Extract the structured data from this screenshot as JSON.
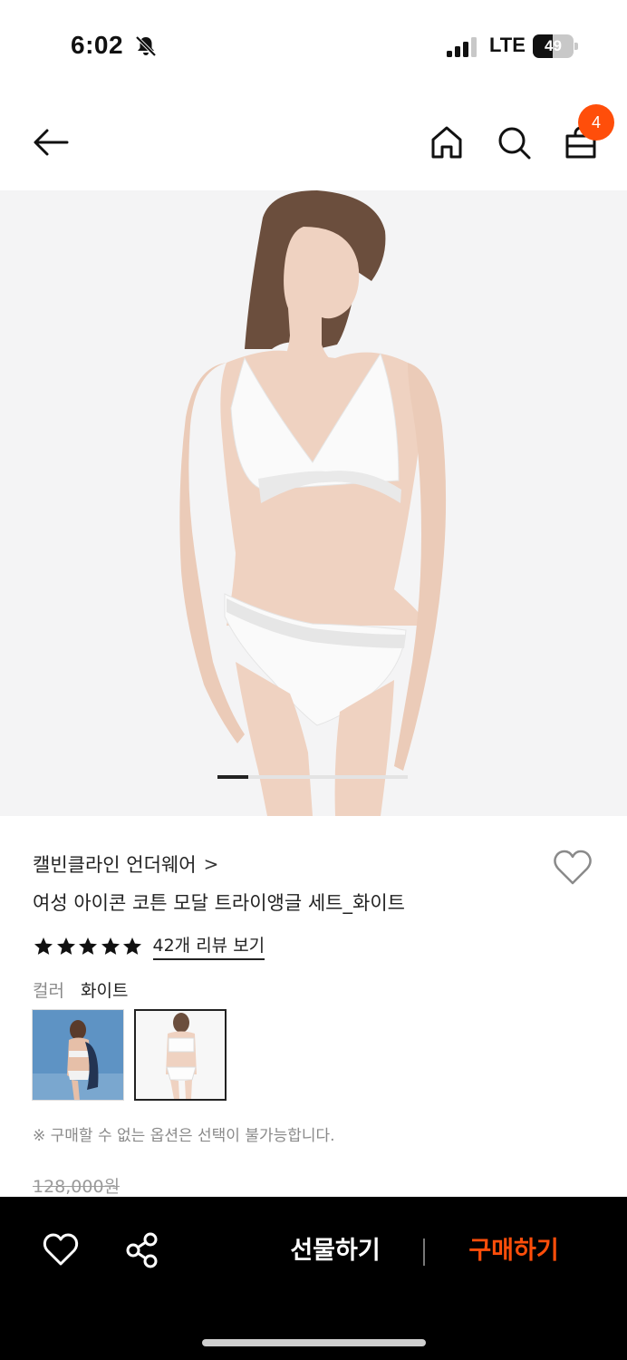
{
  "status_bar": {
    "time": "6:02",
    "network": "LTE",
    "battery_level": 49,
    "battery_text": "49"
  },
  "header": {
    "cart_count": "4",
    "accent_color": "#ff4e0a"
  },
  "carousel": {
    "current_index": 1,
    "total_fraction_shown": 0.16
  },
  "product": {
    "brand": "캘빈클라인 언더웨어",
    "brand_chevron": ">",
    "title": "여성 아이콘 코튼 모달 트라이앵글 세트_화이트",
    "rating_stars": 5,
    "review_link": "42개 리뷰 보기",
    "color_label": "컬러",
    "color_value": "화이트",
    "notice": "※ 구매할 수 없는 옵션은 선택이 불가능합니다.",
    "original_price": "128,000원"
  },
  "bottom_bar": {
    "gift_label": "선물하기",
    "buy_label": "구매하기"
  },
  "icons": [
    "back-arrow-icon",
    "home-icon",
    "search-icon",
    "shopping-bag-icon",
    "heart-icon",
    "share-icon",
    "star-icon",
    "bell-off-icon",
    "signal-icon",
    "battery-icon"
  ]
}
